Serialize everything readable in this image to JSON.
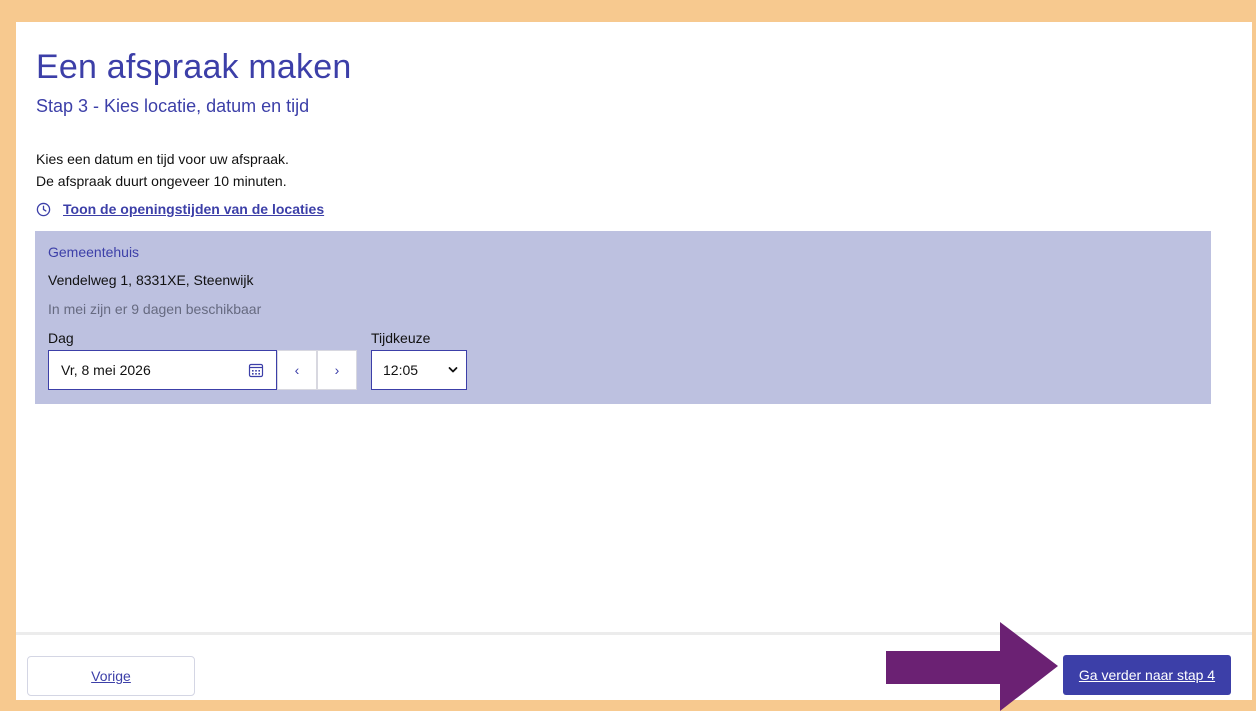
{
  "header": {
    "title": "Een afspraak maken",
    "subtitle": "Stap 3 - Kies locatie, datum en tijd"
  },
  "intro": {
    "line1": "Kies een datum en tijd voor uw afspraak.",
    "line2": "De afspraak duurt ongeveer 10 minuten."
  },
  "opening_hours_link": "Toon de openingstijden van de locaties",
  "location": {
    "name": "Gemeentehuis",
    "address": "Vendelweg 1, 8331XE, Steenwijk",
    "availability": "In mei zijn er 9 dagen beschikbaar",
    "day_label": "Dag",
    "day_value": "Vr, 8 mei 2026",
    "prev_symbol": "‹",
    "next_symbol": "›",
    "time_label": "Tijdkeuze",
    "time_value": "12:05"
  },
  "footer": {
    "prev_label": "Vorige",
    "next_label": "Ga verder naar stap 4"
  },
  "colors": {
    "accent": "#3c3fa8",
    "card": "#bdc1e0",
    "frame": "#f7c98f",
    "arrow": "#6b2173"
  },
  "icons": {
    "clock": "clock-icon",
    "calendar": "calendar-icon",
    "select": "chevron-down-icon",
    "annotation": "arrow-right-icon"
  }
}
